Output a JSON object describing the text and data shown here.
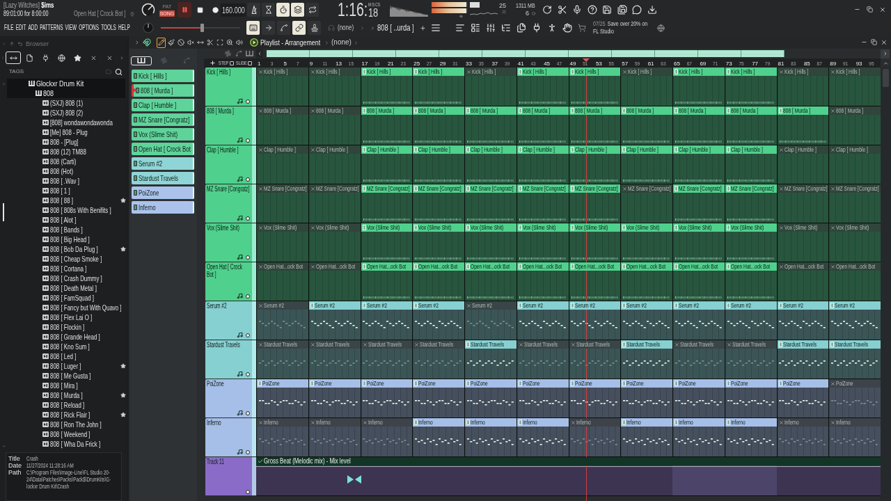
{
  "window": {
    "project": "[Lazy Witches] **$ims**",
    "position": "89:01:00 for 8:00:00",
    "hint": "Open Hat [ Crock Bot ]"
  },
  "transport": {
    "modes": [
      {
        "label": "PAT",
        "selected": false
      },
      {
        "label": "SONG",
        "selected": true
      }
    ],
    "playing": true,
    "tempo": "160.000",
    "time": "1:16:",
    "time_fraction": "18",
    "time_format": "M:S:CS",
    "master_volume": {
      "level": 0.52
    }
  },
  "record_options": [
    {
      "kind": "metronome",
      "on": false
    },
    {
      "kind": "wait",
      "on": false
    },
    {
      "kind": "countdown",
      "on": true
    },
    {
      "kind": "blend",
      "on": true
    },
    {
      "kind": "loop",
      "on": false
    }
  ],
  "meters": {
    "peak": [
      {
        "level": 0.96
      },
      {
        "level": 0.96
      }
    ],
    "cpu": "25",
    "memory": "1311 MB",
    "polyphony": "6"
  },
  "menu": [
    "FILE",
    "EDIT",
    "ADD",
    "PATTERNS",
    "VIEW",
    "OPTIONS",
    "TOOLS",
    "HELP"
  ],
  "toolbar": {
    "toggles": [
      {
        "kind": "keyboard",
        "on": true
      },
      {
        "kind": "step",
        "on": false
      },
      {
        "kind": "curve",
        "on": false
      },
      {
        "kind": "link",
        "on": true
      },
      {
        "kind": "stamp",
        "on": false
      }
    ],
    "channel": "(none)",
    "pattern": "808 [ ..urda ]"
  },
  "news": {
    "date": "07/25",
    "text": "Save over 20% on FL Studio"
  },
  "browser": {
    "title": "Browser",
    "filters": [
      {
        "kind": "all",
        "selected": true
      },
      {
        "kind": "files",
        "selected": false
      },
      {
        "kind": "plugins",
        "selected": false
      },
      {
        "kind": "online",
        "selected": false
      },
      {
        "kind": "starred",
        "selected": false
      }
    ],
    "tags_label": "TAGS",
    "tree": [
      {
        "label": "Glockxr Drum Kit",
        "expanded": true,
        "children": [
          {
            "label": "808",
            "expanded": true,
            "children": [
              {
                "label": "(SXJ) 808 (1)",
                "favorite": false
              },
              {
                "label": "(SXJ) 808 (2)",
                "favorite": false
              },
              {
                "label": "[808] wondawondawonda",
                "favorite": false
              },
              {
                "label": "[Me] 808 - Plug",
                "favorite": false
              },
              {
                "label": "808 - [Plug]",
                "favorite": false
              },
              {
                "label": "808 (12) TM88",
                "favorite": false
              },
              {
                "label": "808 (Carti)",
                "favorite": false
              },
              {
                "label": "808 (Hot)",
                "favorite": false
              },
              {
                "label": "808 [ .Wav ]",
                "favorite": false
              },
              {
                "label": "808 [ 1 ]",
                "favorite": false
              },
              {
                "label": "808 [ 88 ]",
                "favorite": true
              },
              {
                "label": "808 [ 808s With Benifits ]",
                "favorite": false
              },
              {
                "label": "808 [ Alot ]",
                "favorite": false
              },
              {
                "label": "808 [ Bands ]",
                "favorite": false
              },
              {
                "label": "808 [ Big Head ]",
                "favorite": false
              },
              {
                "label": "808 [ Bob Da Plug ]",
                "favorite": true
              },
              {
                "label": "808 [ Cheap Smoke ]",
                "favorite": false
              },
              {
                "label": "808 [ Cortana ]",
                "favorite": false
              },
              {
                "label": "808 [ Crash Dummy ]",
                "favorite": false
              },
              {
                "label": "808 [ Death Metal ]",
                "favorite": false
              },
              {
                "label": "808 [ FamSquad ]",
                "favorite": false
              },
              {
                "label": "808 [ Fancy but With Quavo ]",
                "favorite": false
              },
              {
                "label": "808 [ Flex Lai O ]",
                "favorite": false
              },
              {
                "label": "808 [ Flockin ]",
                "favorite": false
              },
              {
                "label": "808 [ Grande Head ]",
                "favorite": false
              },
              {
                "label": "808 [ Kno Sum ]",
                "favorite": false
              },
              {
                "label": "808 [ Led ]",
                "favorite": false
              },
              {
                "label": "808 [ Luger ]",
                "favorite": true
              },
              {
                "label": "808 [ Me Gusta ]",
                "favorite": false
              },
              {
                "label": "808 [ Mira ]",
                "favorite": false
              },
              {
                "label": "808 [ Murda ]",
                "favorite": true
              },
              {
                "label": "808 [ Reload ]",
                "favorite": false
              },
              {
                "label": "808 [ Rick Flair ]",
                "favorite": true
              },
              {
                "label": "808 [ Ron The John ]",
                "favorite": false
              },
              {
                "label": "808 [ Weekend ]",
                "favorite": false
              },
              {
                "label": "808 [ Wha Da Frick ]",
                "favorite": false
              }
            ]
          }
        ]
      }
    ],
    "info": [
      {
        "key": "Title",
        "value": "Crash"
      },
      {
        "key": "Date",
        "value": "11/27/2024 11:28:16 AM"
      },
      {
        "key": "Path",
        "value": "C:\\Program Files\\Image-Line\\FL Studio 20-24\\Data\\Patches\\Packs\\Pack$\\DrumKits\\G-lockxr Drum Kit\\Crash"
      }
    ]
  },
  "playlist": {
    "title": "Playlist - Arrangement",
    "arrangement": "(none)",
    "tools": [
      {
        "kind": "draw",
        "selected": true
      },
      {
        "kind": "paint",
        "selected": false
      },
      {
        "kind": "delete",
        "selected": false
      },
      {
        "kind": "mute",
        "selected": false
      },
      {
        "kind": "slip",
        "selected": false
      },
      {
        "kind": "slice",
        "selected": false
      },
      {
        "kind": "select",
        "selected": false
      },
      {
        "kind": "zoom",
        "selected": false
      },
      {
        "kind": "playback",
        "selected": false
      }
    ],
    "picker_modes": [
      {
        "kind": "patterns",
        "selected": true
      },
      {
        "kind": "audio",
        "selected": false
      },
      {
        "kind": "automation",
        "selected": false
      }
    ],
    "step_label": "STEP",
    "step": false,
    "slide_label": "SLIDE",
    "slide": false,
    "patterns": [
      {
        "label": "Kick [ Hills ]",
        "color": "#5ed39a",
        "selected": false
      },
      {
        "label": "808 [ Murda ]",
        "color": "#5ed39a",
        "selected": true
      },
      {
        "label": "Clap [ Humble ]",
        "color": "#5ed39a",
        "selected": false
      },
      {
        "label": "MZ Snare [Congratz]",
        "color": "#5ed39a",
        "selected": false
      },
      {
        "label": "Vox (Slime Shit)",
        "color": "#5ed39a",
        "selected": false
      },
      {
        "label": "Open Hat [ Crock Bot",
        "color": "#5ed39a",
        "selected": false
      },
      {
        "label": "Serum #2",
        "color": "#8fd5d7",
        "selected": false
      },
      {
        "label": "Stardust Travels",
        "color": "#8fd5d7",
        "selected": false
      },
      {
        "label": "PoiZone",
        "color": "#abc3ec",
        "selected": false
      },
      {
        "label": "Inferno",
        "color": "#abc3ec",
        "selected": false
      }
    ],
    "ruler": [
      "1",
      "3",
      "5",
      "7",
      "9",
      "11",
      "13",
      "15",
      "17",
      "19",
      "21",
      "23",
      "25",
      "27",
      "29",
      "31",
      "33",
      "35",
      "37",
      "39",
      "41",
      "43",
      "45",
      "47",
      "49",
      "51",
      "53",
      "55",
      "57",
      "59",
      "61",
      "63",
      "65",
      "67",
      "69",
      "71",
      "73",
      "75",
      "77",
      "79",
      "81",
      "83",
      "85",
      "87",
      "89",
      "91",
      "93",
      "95"
    ],
    "playhead": {
      "level": 0.528
    },
    "tracks": [
      {
        "name": "Kick [ Hills ]",
        "color": "#4fd08c",
        "kind": "drums",
        "enabled": true,
        "clips": [
          {
            "label": "Kick [ Hills ]",
            "muted": true
          },
          {
            "label": "Kick [ Hills ]",
            "muted": true
          },
          {
            "label": "Kick [ Hills ]",
            "muted": false
          },
          {
            "label": "Kick [ Hills ]",
            "muted": false
          },
          {
            "label": "Kick [ Hills ]",
            "muted": true
          },
          {
            "label": "Kick [ Hills ]",
            "muted": false
          },
          {
            "label": "Kick [ Hills ]",
            "muted": false
          },
          {
            "label": "Kick [ Hills ]",
            "muted": true
          },
          {
            "label": "Kick [ Hills ]",
            "muted": false
          },
          {
            "label": "Kick [ Hills ]",
            "muted": false
          },
          {
            "label": "Kick [ Hills ]",
            "muted": true
          },
          {
            "label": "Kick [ Hills ]",
            "muted": true
          }
        ]
      },
      {
        "name": "808 [ Murda ]",
        "color": "#4fd08c",
        "kind": "drums",
        "enabled": true,
        "clips": [
          {
            "label": "808 [ Murda ]",
            "muted": true
          },
          {
            "label": "808 [ Murda ]",
            "muted": true
          },
          {
            "label": "808 [ Murda ]",
            "muted": false
          },
          {
            "label": "808 [ Murda ]",
            "muted": false
          },
          {
            "label": "808 [ Murda ]",
            "muted": false
          },
          {
            "label": "808 [ Murda ]",
            "muted": false
          },
          {
            "label": "808 [ Murda ]",
            "muted": false
          },
          {
            "label": "808 [ Murda ]",
            "muted": false
          },
          {
            "label": "808 [ Murda ]",
            "muted": false
          },
          {
            "label": "808 [ Murda ]",
            "muted": false
          },
          {
            "label": "808 [ Murda ]",
            "muted": false
          },
          {
            "label": "808 [ Murda ]",
            "muted": true
          }
        ]
      },
      {
        "name": "Clap [ Humble ]",
        "color": "#4fd08c",
        "kind": "drums",
        "enabled": true,
        "clips": [
          {
            "label": "Clap [ Humble ]",
            "muted": true
          },
          {
            "label": "Clap [ Humble ]",
            "muted": true
          },
          {
            "label": "Clap [ Humble ]",
            "muted": false
          },
          {
            "label": "Clap [ Humble ]",
            "muted": false
          },
          {
            "label": "Clap [ Humble ]",
            "muted": false
          },
          {
            "label": "Clap [ Humble ]",
            "muted": false
          },
          {
            "label": "Clap [ Humble ]",
            "muted": false
          },
          {
            "label": "Clap [ Humble ]",
            "muted": false
          },
          {
            "label": "Clap [ Humble ]",
            "muted": false
          },
          {
            "label": "Clap [ Humble ]",
            "muted": false
          },
          {
            "label": "Clap [ Humble ]",
            "muted": true
          },
          {
            "label": "Clap [ Humble ]",
            "muted": true
          }
        ]
      },
      {
        "name": "MZ Snare [Congratz]",
        "color": "#4fd08c",
        "kind": "drums",
        "enabled": true,
        "clips": [
          {
            "label": "MZ Snare [Congratz]",
            "muted": true
          },
          {
            "label": "MZ Snare [Congratz]",
            "muted": true
          },
          {
            "label": "MZ Snare [Congratz]",
            "muted": false
          },
          {
            "label": "MZ Snare [Congratz]",
            "muted": false
          },
          {
            "label": "MZ Snare [Congratz]",
            "muted": false
          },
          {
            "label": "MZ Snare [Congratz]",
            "muted": false
          },
          {
            "label": "MZ Snare [Congratz]",
            "muted": false
          },
          {
            "label": "MZ Snare [Congratz]",
            "muted": true
          },
          {
            "label": "MZ Snare [Congratz]",
            "muted": false
          },
          {
            "label": "MZ Snare [Congratz]",
            "muted": false
          },
          {
            "label": "MZ Snare [Congratz]",
            "muted": true
          },
          {
            "label": "MZ Snare [Congratz]",
            "muted": true
          }
        ]
      },
      {
        "name": "Vox (Slime Shit)",
        "color": "#4fd08c",
        "kind": "drums",
        "enabled": true,
        "clips": [
          {
            "label": "Vox (Slime Shit)",
            "muted": true
          },
          {
            "label": "Vox (Slime Shit)",
            "muted": true
          },
          {
            "label": "Vox (Slime Shit)",
            "muted": false
          },
          {
            "label": "Vox (Slime Shit)",
            "muted": false
          },
          {
            "label": "Vox (Slime Shit)",
            "muted": false
          },
          {
            "label": "Vox (Slime Shit)",
            "muted": false
          },
          {
            "label": "Vox (Slime Shit)",
            "muted": false
          },
          {
            "label": "Vox (Slime Shit)",
            "muted": false
          },
          {
            "label": "Vox (Slime Shit)",
            "muted": false
          },
          {
            "label": "Vox (Slime Shit)",
            "muted": false
          },
          {
            "label": "Vox (Slime Shit)",
            "muted": true
          },
          {
            "label": "Vox (Slime Shit)",
            "muted": true
          }
        ]
      },
      {
        "name": "Open Hat [ Crock Bot ]",
        "color": "#4fd08c",
        "kind": "drums",
        "enabled": true,
        "clips": [
          {
            "label": "Open Hat...ock Bot",
            "muted": true
          },
          {
            "label": "Open Hat...ock Bot",
            "muted": true
          },
          {
            "label": "Open Hat...ock Bot",
            "muted": false
          },
          {
            "label": "Open Hat...ock Bot",
            "muted": false
          },
          {
            "label": "Open Hat...ock Bot",
            "muted": false
          },
          {
            "label": "Open Hat...ock Bot",
            "muted": false
          },
          {
            "label": "Open Hat...ock Bot",
            "muted": false
          },
          {
            "label": "Open Hat...ock Bot",
            "muted": false
          },
          {
            "label": "Open Hat...ock Bot",
            "muted": false
          },
          {
            "label": "Open Hat...ock Bot",
            "muted": false
          },
          {
            "label": "Open Hat...ock Bot",
            "muted": true
          },
          {
            "label": "Open Hat...ock Bot",
            "muted": true
          }
        ]
      },
      {
        "name": "Serum #2",
        "color": "#86d0d2",
        "kind": "synth",
        "enabled": true,
        "clips": [
          {
            "label": "Serum #2",
            "muted": true
          },
          {
            "label": "Serum #2",
            "muted": false
          },
          {
            "label": "Serum #2",
            "muted": false
          },
          {
            "label": "Serum #2",
            "muted": false
          },
          {
            "label": "Serum #2",
            "muted": true
          },
          {
            "label": "Serum #2",
            "muted": false
          },
          {
            "label": "Serum #2",
            "muted": false
          },
          {
            "label": "Serum #2",
            "muted": false
          },
          {
            "label": "Serum #2",
            "muted": false
          },
          {
            "label": "Serum #2",
            "muted": false
          },
          {
            "label": "Serum #2",
            "muted": false
          },
          {
            "label": "Serum #2",
            "muted": false
          }
        ]
      },
      {
        "name": "Stardust Travels",
        "color": "#86d0d2",
        "kind": "synth",
        "enabled": true,
        "clips": [
          {
            "label": "Stardust Travels",
            "muted": true
          },
          {
            "label": "Stardust Travels",
            "muted": true
          },
          {
            "label": "Stardust Travels",
            "muted": true
          },
          {
            "label": "Stardust Travels",
            "muted": true
          },
          {
            "label": "Stardust Travels",
            "muted": false
          },
          {
            "label": "Stardust Travels",
            "muted": true
          },
          {
            "label": "Stardust Travels",
            "muted": true
          },
          {
            "label": "Stardust Travels",
            "muted": false
          },
          {
            "label": "Stardust Travels",
            "muted": true
          },
          {
            "label": "Stardust Travels",
            "muted": true
          },
          {
            "label": "Stardust Travels",
            "muted": false
          },
          {
            "label": "Stardust Travels",
            "muted": false
          }
        ]
      },
      {
        "name": "PoiZone",
        "color": "#a6bfe8",
        "kind": "synth",
        "enabled": true,
        "clips": [
          {
            "label": "PoiZone",
            "muted": false
          },
          {
            "label": "PoiZone",
            "muted": false
          },
          {
            "label": "PoiZone",
            "muted": false
          },
          {
            "label": "PoiZone",
            "muted": false
          },
          {
            "label": "PoiZone",
            "muted": false
          },
          {
            "label": "PoiZone",
            "muted": false
          },
          {
            "label": "PoiZone",
            "muted": false
          },
          {
            "label": "PoiZone",
            "muted": false
          },
          {
            "label": "PoiZone",
            "muted": false
          },
          {
            "label": "PoiZone",
            "muted": false
          },
          {
            "label": "PoiZone",
            "muted": false
          },
          {
            "label": "PoiZone",
            "muted": true
          }
        ]
      },
      {
        "name": "Inferno",
        "color": "#a6bfe8",
        "kind": "synth",
        "enabled": true,
        "clips": [
          {
            "label": "Inferno",
            "muted": true
          },
          {
            "label": "Inferno",
            "muted": true
          },
          {
            "label": "Inferno",
            "muted": true
          },
          {
            "label": "Inferno",
            "muted": false
          },
          {
            "label": "Inferno",
            "muted": false
          },
          {
            "label": "Inferno",
            "muted": false
          },
          {
            "label": "Inferno",
            "muted": true
          },
          {
            "label": "Inferno",
            "muted": false
          },
          {
            "label": "Inferno",
            "muted": false
          },
          {
            "label": "Inferno",
            "muted": false
          },
          {
            "label": "Inferno",
            "muted": true
          },
          {
            "label": "Inferno",
            "muted": true
          }
        ]
      },
      {
        "name": "Track 11",
        "color": "#8a6cc8",
        "kind": "automation",
        "enabled": true,
        "clips": [
          {
            "label": "Gross Beat (Melodic mix) - Mix level",
            "muted": false
          }
        ]
      }
    ]
  }
}
